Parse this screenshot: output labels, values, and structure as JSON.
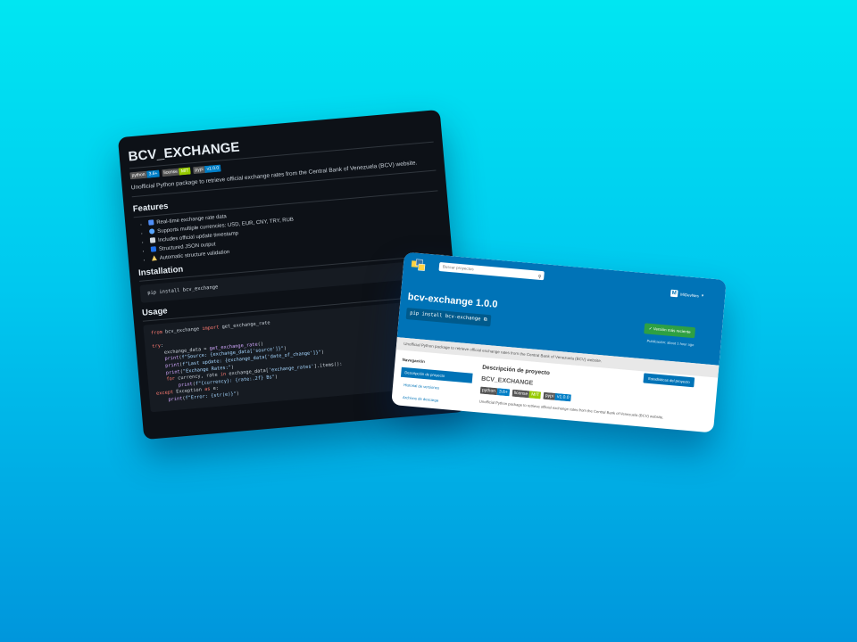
{
  "readme": {
    "title": "BCV_EXCHANGE",
    "badges": [
      {
        "label": "python",
        "value": "3.6+",
        "color": "#007ec6"
      },
      {
        "label": "license",
        "value": "MIT",
        "color": "#97ca00"
      },
      {
        "label": "pypi",
        "value": "v1.0.0",
        "color": "#007ec6"
      }
    ],
    "description": "Unofficial Python package to retrieve official exchange rates from the Central Bank of Venezuela (BCV) website.",
    "features_heading": "Features",
    "features": [
      {
        "icon": "chart-icon",
        "color": "#4f8ef7",
        "text": "Real-time exchange rate data"
      },
      {
        "icon": "globe-icon",
        "color": "#58a6ff",
        "text": "Supports multiple currencies: USD, EUR, CNY, TRY, RUB"
      },
      {
        "icon": "calendar-icon",
        "color": "#d0d7de",
        "text": "Includes official update timestamp"
      },
      {
        "icon": "json-icon",
        "color": "#1f6feb",
        "text": "Structured JSON output"
      },
      {
        "icon": "warning-icon",
        "color": "#f2cc60",
        "text": "Automatic structure validation"
      }
    ],
    "installation_heading": "Installation",
    "install_cmd": "pip install bcv_exchange",
    "usage_heading": "Usage"
  },
  "pypi": {
    "search_placeholder": "Buscar proyectos",
    "user": "MiDevNes",
    "package_title": "bcv-exchange 1.0.0",
    "pip_cmd": "pip install bcv-exchange",
    "latest_label": "Versión más reciente",
    "published": "Publicación: about 1 hour ago",
    "summary": "Unofficial Python package to retrieve official exchange rates from the Central Bank of Venezuela (BCV) website.",
    "nav_title": "Navegación",
    "nav_items": [
      "Descripción de proyecto",
      "Historial de versiones",
      "Archivos de descarga"
    ],
    "main_heading": "Descripción de proyecto",
    "readme_title": "BCV_EXCHANGE",
    "badges": [
      {
        "label": "python",
        "value": "3.6+",
        "color": "#007ec6"
      },
      {
        "label": "license",
        "value": "MIT",
        "color": "#97ca00"
      },
      {
        "label": "pypi",
        "value": "v1.0.0",
        "color": "#007ec6"
      }
    ],
    "readme_desc": "Unofficial Python package to retrieve official exchange rates from the Central Bank of Venezuela (BCV) website.",
    "stats_button": "Estadísticas del proyecto"
  }
}
